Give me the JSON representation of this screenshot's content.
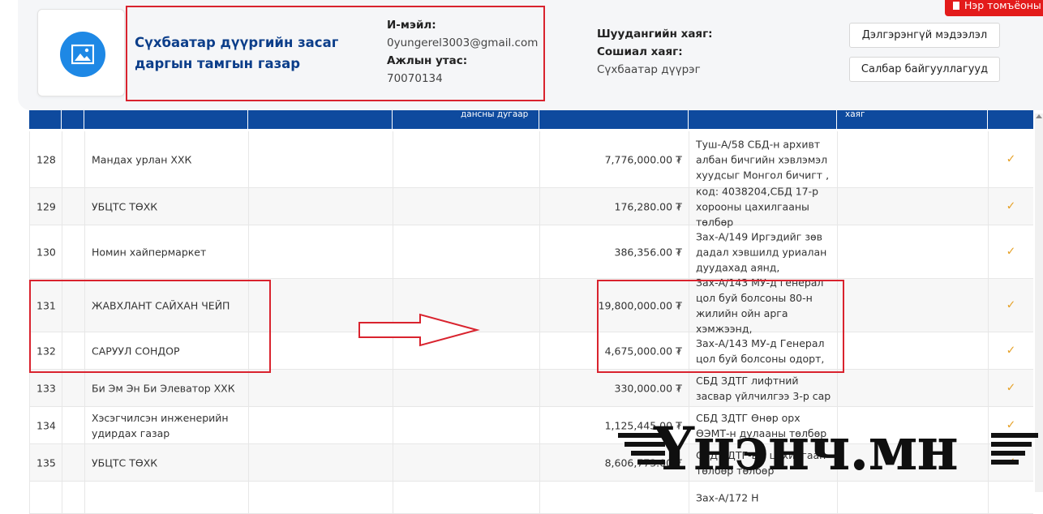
{
  "org": {
    "name": "Сүхбаатар дүүргийн засаг даргын тамгын газар",
    "email_label": "И-мэйл:",
    "email": "0yungerel3003@gmail.com",
    "phone_label": "Ажлын утас:",
    "phone": "70070134",
    "mail_address_label": "Шуудангийн хаяг:",
    "social_label": "Сошиал хаяг:",
    "district": "Сүхбаатар дүүрэг"
  },
  "buttons": {
    "details": "Дэлгэрэнгүй мэдээлэл",
    "branches": "Салбар байгууллагууд",
    "report": "Нэр томъёоны"
  },
  "table": {
    "header_fragments": [
      "дансны дугаар",
      "хаяг"
    ],
    "rows": [
      {
        "num": "128",
        "name": "Мандах урлан ХХК",
        "amount": "7,776,000.00 ₮",
        "desc": "Туш-А/58 СБД-н архивт албан бичгийн хэвлэмэл хуудсыг Монгол бичигт ,",
        "check": "✓"
      },
      {
        "num": "129",
        "name": "УБЦТС ТӨХК",
        "amount": "176,280.00 ₮",
        "desc": "код: 4038204,СБД 17-р хорооны цахилгааны төлбөр",
        "check": "✓"
      },
      {
        "num": "130",
        "name": "Номин хайпермаркет",
        "amount": "386,356.00 ₮",
        "desc": "Зах-А/149 Иргэдийг зөв дадал хэвшилд уриалан дуудахад аянд,",
        "check": "✓"
      },
      {
        "num": "131",
        "name": "ЖАВХЛАНТ САЙХАН ЧЕЙП",
        "amount": "19,800,000.00 ₮",
        "desc": "Зах-А/143 МУ-д генерал цол буй болсоны 80-н жилийн ойн арга хэмжээнд,",
        "check": "✓"
      },
      {
        "num": "132",
        "name": "САРУУЛ СОНДОР",
        "amount": "4,675,000.00 ₮",
        "desc": "Зах-А/143 МУ-д Генерал цол буй болсоны одорт,",
        "check": "✓"
      },
      {
        "num": "133",
        "name": "Би Эм Эн Би Элеватор ХХК",
        "amount": "330,000.00 ₮",
        "desc": "СБД ЗДТГ лифтний засвар үйлчилгээ 3-р сар",
        "check": "✓"
      },
      {
        "num": "134",
        "name": "Хэсэгчилсэн инженерийн удирдах газар",
        "amount": "1,125,445.00 ₮",
        "desc": "СБД ЗДТГ Өнөр орх ӨЭМТ-н дулааны төлбөр",
        "check": "✓"
      },
      {
        "num": "135",
        "name": "УБЦТС ТӨХК",
        "amount": "8,606,773.00 ₮",
        "desc": "СБД ЗДТГ-ын цахилгаан төлбөр төлбөр",
        "check": "✓"
      },
      {
        "num": "",
        "name": "",
        "amount": "",
        "desc": "Зах-А/172 Н",
        "check": ""
      }
    ]
  },
  "watermark": {
    "text": "Үнэнч.мн"
  }
}
